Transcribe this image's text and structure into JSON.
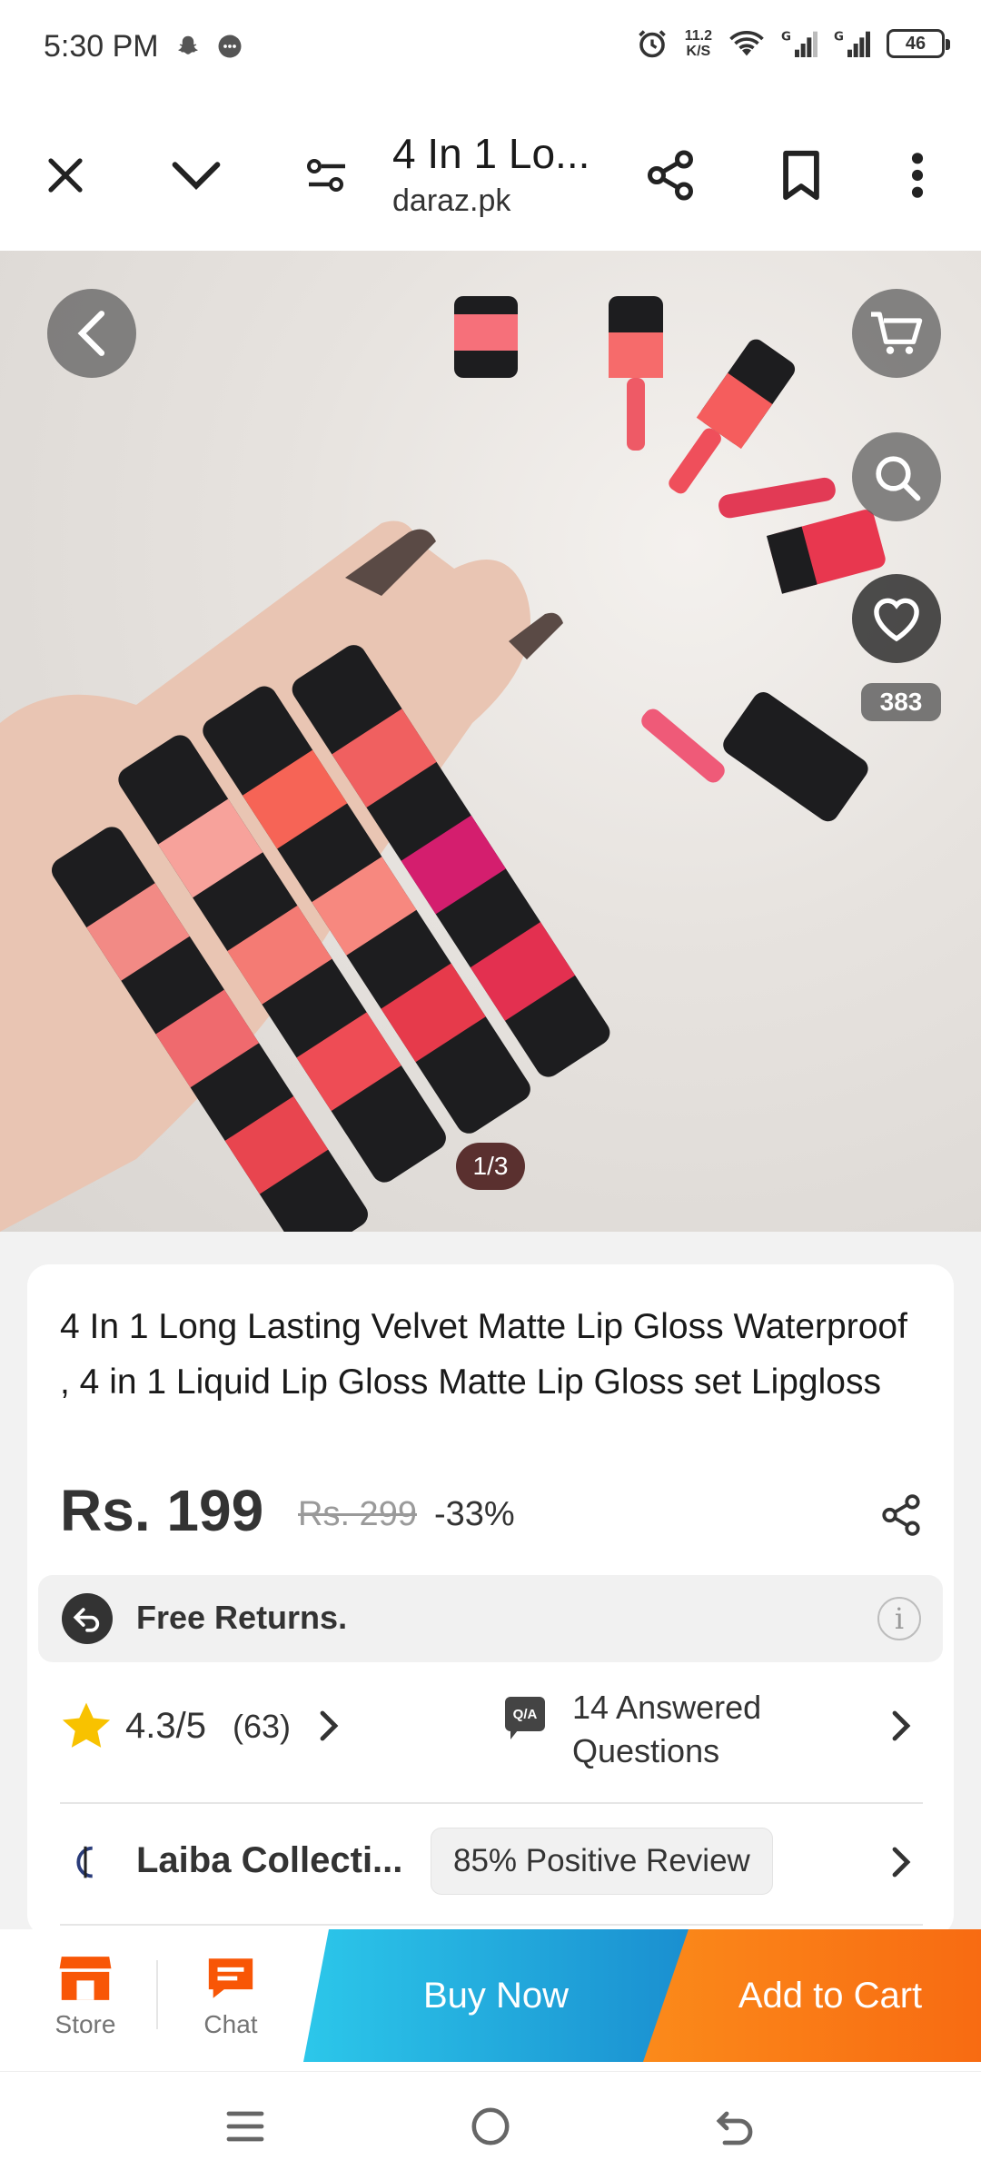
{
  "status_bar": {
    "time": "5:30 PM",
    "net_speed_value": "11.2",
    "net_speed_unit": "K/S",
    "battery": "46",
    "icons": [
      "snapchat-icon",
      "chat-bubble-icon",
      "alarm-icon",
      "wifi-icon",
      "signal-icon",
      "signal-icon",
      "battery-icon"
    ]
  },
  "browser_bar": {
    "page_title": "4 In 1 Lo...",
    "domain": "daraz.pk",
    "icons": [
      "close-icon",
      "chevron-down-icon",
      "site-settings-icon",
      "share-icon",
      "bookmark-icon",
      "more-vert-icon"
    ]
  },
  "gallery": {
    "like_count": "383",
    "page_indicator": "1/3",
    "icons": [
      "back-arrow-icon",
      "cart-icon",
      "search-icon",
      "heart-icon"
    ]
  },
  "product": {
    "title": "4 In 1 Long Lasting Velvet Matte Lip Gloss Waterproof , 4 in 1 Liquid Lip Gloss Matte Lip Gloss set Lipgloss",
    "price": "Rs. 199",
    "original_price": "Rs. 299",
    "discount": "-33%",
    "returns_label": "Free Returns.",
    "info_glyph": "i",
    "rating": "4.3/5",
    "rating_count": "(63)",
    "qa_badge": "Q/A",
    "qa_text": "14 Answered Questions",
    "seller_name": "Laiba Collecti...",
    "seller_positive": "85% Positive Review"
  },
  "action_bar": {
    "store_label": "Store",
    "chat_label": "Chat",
    "buy_now_label": "Buy Now",
    "add_to_cart_label": "Add to Cart"
  },
  "colors": {
    "buy_now_start": "#2cc7ea",
    "buy_now_end": "#1a8fd0",
    "add_to_cart_start": "#fb8a1a",
    "add_to_cart_end": "#f86b12",
    "brand_orange": "#f85606",
    "star": "#f8c200"
  }
}
